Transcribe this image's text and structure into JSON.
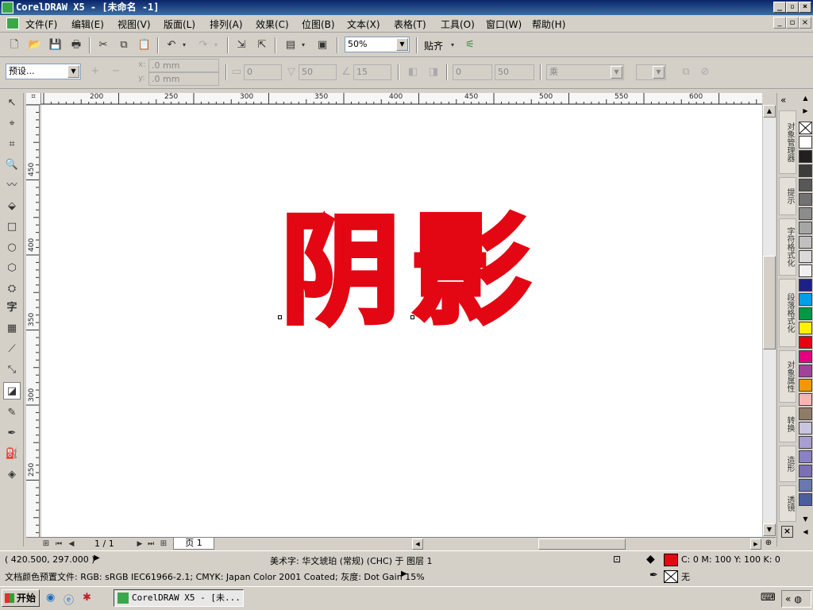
{
  "window": {
    "title": "CorelDRAW X5 - [未命名 -1]"
  },
  "menu": [
    "文件(F)",
    "编辑(E)",
    "视图(V)",
    "版面(L)",
    "排列(A)",
    "效果(C)",
    "位图(B)",
    "文本(X)",
    "表格(T)",
    "工具(O)",
    "窗口(W)",
    "帮助(H)"
  ],
  "toolbar": {
    "zoom_value": "50%",
    "snap_label": "贴齐"
  },
  "propbar": {
    "preset_value": "预设...",
    "x_value": ".0 mm",
    "y_value": ".0 mm",
    "x_label": "x:",
    "y_label": "y:",
    "opacity_value": "0",
    "feather_value": "50",
    "angle_value": "15",
    "stretch_value": "0",
    "fade_value": "50",
    "mode_value": "乘"
  },
  "ruler": {
    "top_ticks": [
      "200",
      "250",
      "300",
      "350",
      "400",
      "450",
      "500",
      "550",
      "600"
    ],
    "left_ticks": [
      "450",
      "400",
      "350",
      "300",
      "250"
    ]
  },
  "canvas": {
    "text": "阴影",
    "text_color": "#e30613"
  },
  "pagebar": {
    "page_count": "1 / 1",
    "page_tab": "页 1"
  },
  "dockers": [
    "对象管理器",
    "提示",
    "字符格式化",
    "段落格式化",
    "对象属性",
    "转换",
    "造形",
    "透镜"
  ],
  "palette_colors": [
    "#ffffff",
    "#231f20",
    "#3c3c3c",
    "#585858",
    "#727272",
    "#8c8c8c",
    "#a6a6a6",
    "#c0c0c0",
    "#dadada",
    "#f0f0f0",
    "#1d2087",
    "#00a0e9",
    "#009944",
    "#fff100",
    "#e60012",
    "#e4007f",
    "#a0429c",
    "#f39800",
    "#f4b5b5",
    "#8e7c68",
    "#c9c5e0",
    "#a79fd0",
    "#8a82c4",
    "#7b6fb6",
    "#6a78b0",
    "#4a5ea0"
  ],
  "status": {
    "coords": "( 420.500, 297.000 )",
    "object_info": "美术字: 华文琥珀 (常规) (CHC) 于 图层 1",
    "fill_info": "C: 0 M: 100 Y: 100 K: 0",
    "outline_info": "无",
    "color_profile": "文档颜色预置文件: RGB: sRGB IEC61966-2.1; CMYK: Japan Color 2001 Coated; 灰度: Dot Gain 15%",
    "fill_color": "#e30613"
  },
  "taskbar": {
    "start_label": "开始",
    "task_label": "CorelDRAW X5 - [未..."
  }
}
